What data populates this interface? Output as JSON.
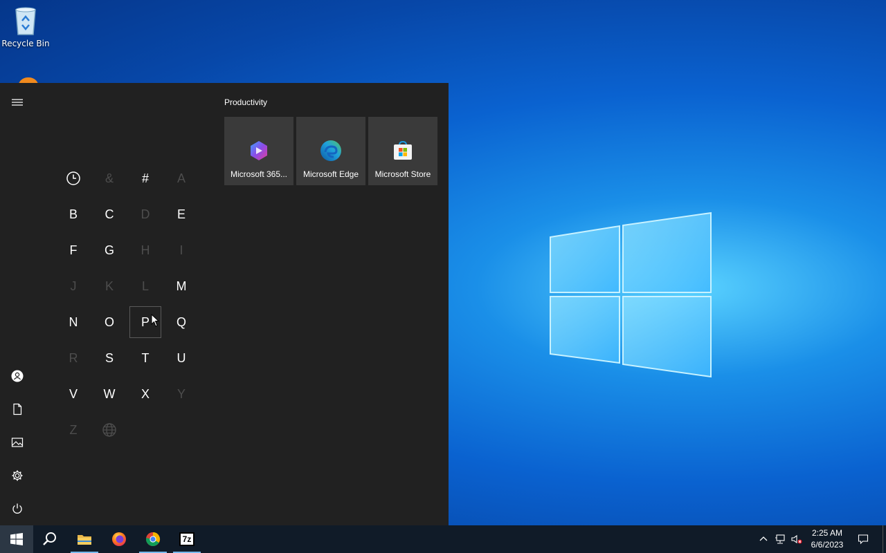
{
  "desktop": {
    "recycle_bin_label": "Recycle Bin"
  },
  "start_menu": {
    "group_title": "Productivity",
    "tiles": [
      {
        "label": "Microsoft 365...",
        "icon": "microsoft-365-icon"
      },
      {
        "label": "Microsoft Edge",
        "icon": "edge-icon"
      },
      {
        "label": "Microsoft Store",
        "icon": "store-icon"
      }
    ],
    "letters": [
      {
        "text": "",
        "icon": "clock-icon",
        "enabled": true
      },
      {
        "text": "&",
        "enabled": false
      },
      {
        "text": "#",
        "enabled": true
      },
      {
        "text": "A",
        "enabled": false
      },
      {
        "text": "B",
        "enabled": true
      },
      {
        "text": "C",
        "enabled": true
      },
      {
        "text": "D",
        "enabled": false
      },
      {
        "text": "E",
        "enabled": true
      },
      {
        "text": "F",
        "enabled": true
      },
      {
        "text": "G",
        "enabled": true
      },
      {
        "text": "H",
        "enabled": false
      },
      {
        "text": "I",
        "enabled": false
      },
      {
        "text": "J",
        "enabled": false
      },
      {
        "text": "K",
        "enabled": false
      },
      {
        "text": "L",
        "enabled": false
      },
      {
        "text": "M",
        "enabled": true
      },
      {
        "text": "N",
        "enabled": true
      },
      {
        "text": "O",
        "enabled": true
      },
      {
        "text": "P",
        "enabled": true,
        "selected": true
      },
      {
        "text": "Q",
        "enabled": true
      },
      {
        "text": "R",
        "enabled": false
      },
      {
        "text": "S",
        "enabled": true
      },
      {
        "text": "T",
        "enabled": true
      },
      {
        "text": "U",
        "enabled": true
      },
      {
        "text": "V",
        "enabled": true
      },
      {
        "text": "W",
        "enabled": true
      },
      {
        "text": "X",
        "enabled": true
      },
      {
        "text": "Y",
        "enabled": false
      },
      {
        "text": "Z",
        "enabled": false
      },
      {
        "text": "",
        "icon": "globe-icon",
        "enabled": false
      }
    ],
    "rail": [
      "hamburger-icon",
      "user-icon",
      "documents-icon",
      "pictures-icon",
      "settings-icon",
      "power-icon"
    ]
  },
  "taskbar": {
    "apps": [
      "start-icon",
      "search-icon",
      "file-explorer-icon",
      "firefox-icon",
      "chrome-icon",
      "7zip-icon"
    ],
    "clock_time": "2:25 AM",
    "clock_date": "6/6/2023",
    "seven_zip_label": "7z"
  },
  "colors": {
    "start_bg": "#212121",
    "tile_bg": "#3a3a3a",
    "taskbar_bg": "#101b28",
    "accent": "#76b9ed"
  }
}
